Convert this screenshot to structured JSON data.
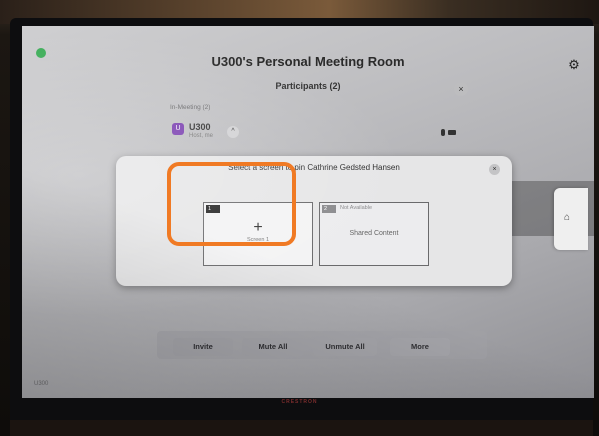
{
  "header": {
    "room_title": "U300's Personal Meeting Room",
    "gear_icon": "gear-icon",
    "status_icon": "check-badge"
  },
  "participants_panel": {
    "title": "Participants (2)",
    "close_symbol": "×",
    "section_label": "In-Meeting (2)",
    "participant": {
      "avatar_text": "U",
      "name": "U300",
      "role": "Host, me",
      "chevron": "^"
    }
  },
  "modal": {
    "title": "Select a screen to pin Cathrine Gedsted Hansen",
    "close_symbol": "×",
    "options": [
      {
        "number": "1",
        "icon": "+",
        "label": "Screen 1"
      },
      {
        "number": "2",
        "status": "Not Available",
        "label": "Shared Content"
      }
    ],
    "highlight_color": "#f07a24"
  },
  "actions": {
    "invite": "Invite",
    "mute_all": "Mute All",
    "unmute_all": "Unmute All",
    "more": "More"
  },
  "side_tab": {
    "home_icon": "home-icon",
    "home_symbol": "⌂"
  },
  "footer": {
    "room_code": "U300",
    "brand": "CRESTRON"
  }
}
